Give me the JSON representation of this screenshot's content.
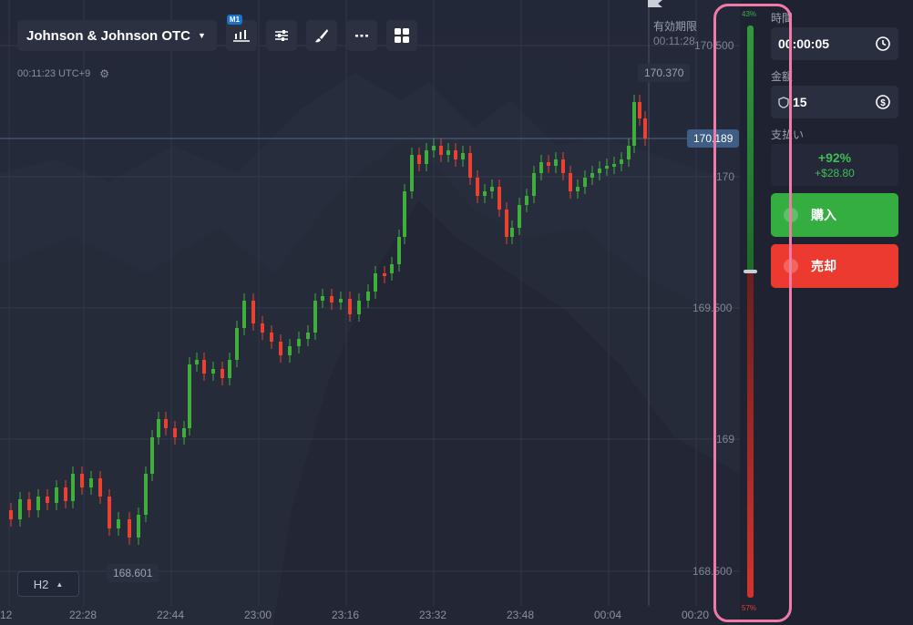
{
  "toolbar": {
    "asset_name": "Johnson & Johnson OTC",
    "timeframe_badge": "M1"
  },
  "chart_info": {
    "clock": "00:11:23 UTC+9"
  },
  "expiry": {
    "label": "有効期限",
    "time": "00:11:28"
  },
  "price_tags": {
    "high": "170.370",
    "current": "170.189",
    "low": "168.601"
  },
  "y_axis_labels": [
    "170.500",
    "170",
    "169.500",
    "169",
    "168.500"
  ],
  "x_axis_labels": [
    "12",
    "22:28",
    "22:44",
    "23:00",
    "23:16",
    "23:32",
    "23:48",
    "00:04",
    "00:20"
  ],
  "timeframe_selector": "H2",
  "sentiment": {
    "buy_percent": "43%",
    "sell_percent": "57%",
    "buy_fraction": 0.43
  },
  "panel": {
    "time_label": "時間",
    "time_value": "00:00:05",
    "amount_label": "金額",
    "amount_value": "15",
    "payout_label": "支払い",
    "payout_percent": "+92%",
    "payout_amount": "+$28.80",
    "buy_label": "購入",
    "sell_label": "売却"
  },
  "colors": {
    "up": "#3fae3a",
    "down": "#ea4130",
    "buy": "#34ae40",
    "sell": "#ed3a30",
    "accent": "#1e73c9",
    "highlight": "#f07aa8"
  }
}
